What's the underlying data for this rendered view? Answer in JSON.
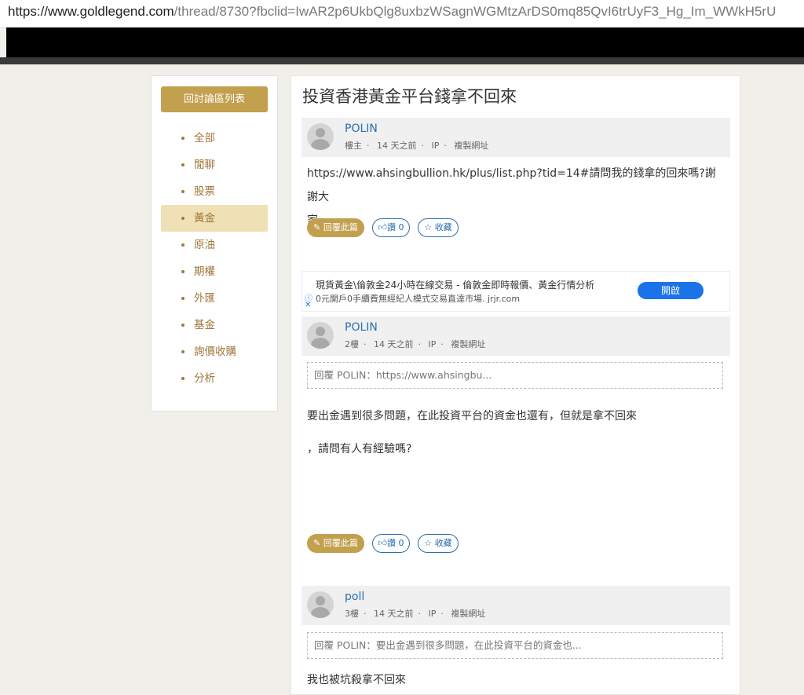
{
  "browser": {
    "url_host": "https://www.goldlegend.com",
    "url_path": "/thread/8730?fbclid=IwAR2p6UkbQlg8uxbzWSagnWGMtzArDS0mq85QvI6trUyF3_Hg_Im_WWkH5rU"
  },
  "sidebar": {
    "back_label": "回討論區列表",
    "items": [
      {
        "label": "全部"
      },
      {
        "label": "閒聊"
      },
      {
        "label": "股票"
      },
      {
        "label": "黃金"
      },
      {
        "label": "原油"
      },
      {
        "label": "期權"
      },
      {
        "label": "外匯"
      },
      {
        "label": "基金"
      },
      {
        "label": "詢價收購"
      },
      {
        "label": "分析"
      }
    ],
    "active_index": 3
  },
  "thread": {
    "title": "投資香港黃金平台錢拿不回來"
  },
  "posts": [
    {
      "author": "POLIN",
      "floor": "樓主",
      "time": "14 天之前",
      "ip": "IP",
      "copy": "複製網址",
      "body_line1": "https://www.ahsingbullion.hk/plus/list.php?tid=14#請問我的錢拿的回來嗎?謝謝大",
      "body_line2": "家",
      "reply_label": "回覆此篇",
      "like_label": "讚 0",
      "fav_label": "收藏"
    },
    {
      "author": "POLIN",
      "floor": "2樓",
      "time": "14 天之前",
      "ip": "IP",
      "copy": "複製網址",
      "quote": "回覆 POLIN：https://www.ahsingbu...",
      "body_line1": "要出金遇到很多問題，在此投資平台的資金也還有，但就是拿不回來",
      "body_line2": "，請問有人有經驗嗎?",
      "reply_label": "回覆此篇",
      "like_label": "讚 0",
      "fav_label": "收藏"
    },
    {
      "author": "poll",
      "floor": "3樓",
      "time": "14 天之前",
      "ip": "IP",
      "copy": "複製網址",
      "quote": "回覆 POLIN：要出金遇到很多問題，在此投資平台的資金也...",
      "body_line1": "我也被坑殺拿不回來"
    }
  ],
  "ad": {
    "title": "現貨黃金\\倫敦金24小時在線交易 - 倫敦金即時報價、黃金行情分析",
    "subtitle": "0元開戶0手續費無經紀人模式交易直達市場. jrjr.com",
    "button": "開啟"
  },
  "icons": {
    "pencil": "pencil-icon",
    "thumb": "thumbs-up-icon",
    "star": "star-icon",
    "info": "info-icon",
    "close": "close-icon"
  },
  "colors": {
    "accent_gold": "#c2a04e",
    "active_bg": "#efe0b5",
    "link_blue": "#2a6fb0",
    "ad_blue": "#1a73e8"
  }
}
